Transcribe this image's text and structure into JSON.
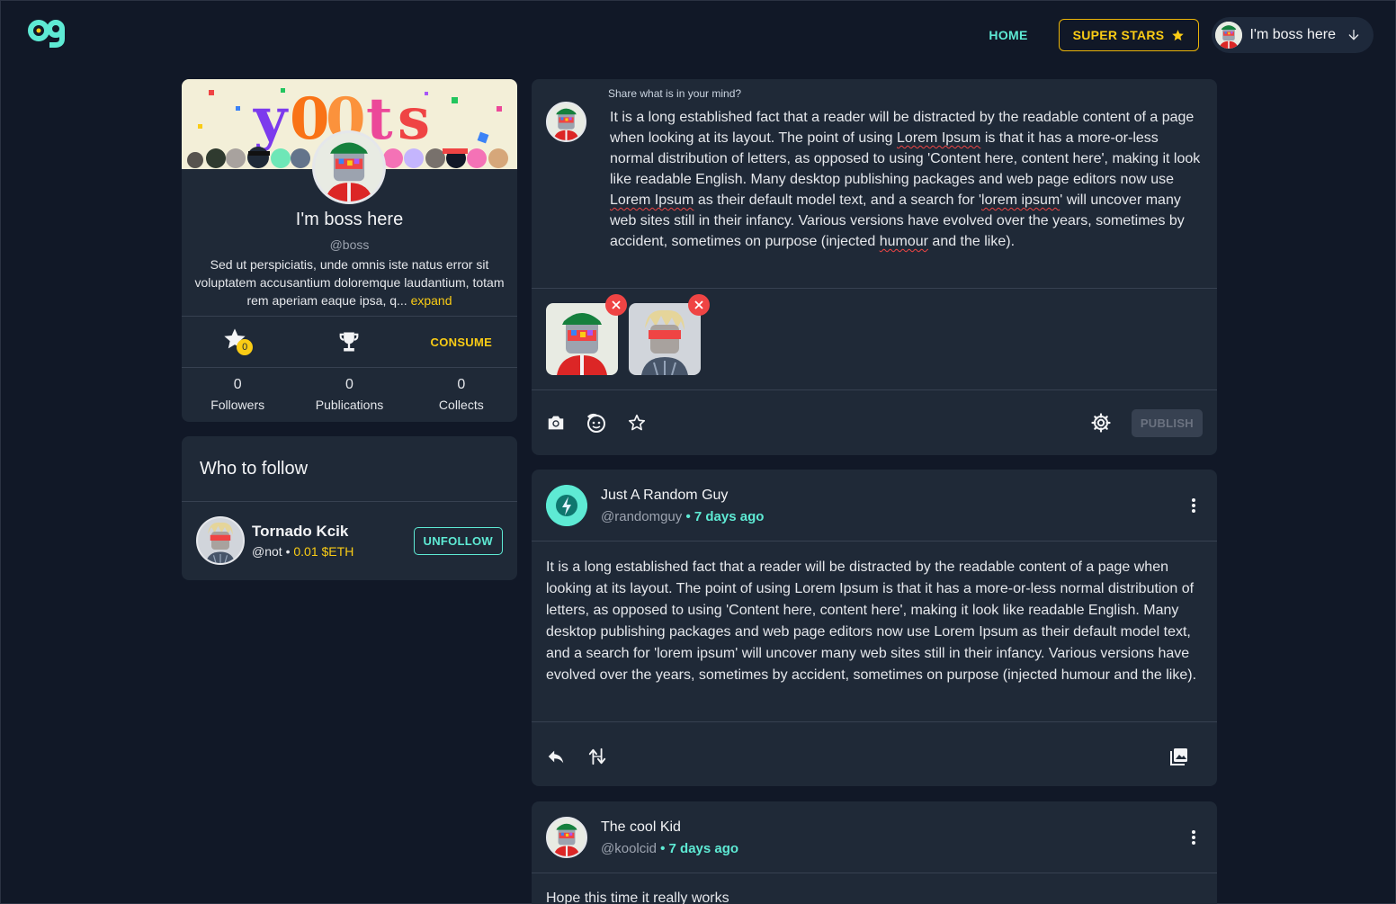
{
  "header": {
    "home_label": "HOME",
    "superstars_label": "SUPER STARS",
    "user_label": "I'm boss here"
  },
  "profile": {
    "name": "I'm boss here",
    "handle": "@boss",
    "bio": "Sed ut perspiciatis, unde omnis iste natus error sit voluptatem accusantium doloremque laudantium, totam rem aperiam eaque ipsa, q...",
    "expand_label": "expand",
    "star_count": "0",
    "consume_label": "CONSUME",
    "stats": [
      {
        "value": "0",
        "label": "Followers"
      },
      {
        "value": "0",
        "label": "Publications"
      },
      {
        "value": "0",
        "label": "Collects"
      }
    ]
  },
  "who_to_follow": {
    "title": "Who to follow",
    "items": [
      {
        "name": "Tornado Kcik",
        "handle": "@not",
        "price": "0.01 $ETH",
        "action": "UNFOLLOW"
      }
    ]
  },
  "composer": {
    "label": "Share what is in your mind?",
    "text_parts": [
      "It is a long established fact that a reader will be distracted by the readable content of a page when looking at its layout. The point of using ",
      "Lorem Ipsum",
      " is that it has a more-or-less normal distribution of letters, as opposed to using 'Content here, content here', making it look like readable English. Many desktop publishing packages and web page editors now use ",
      "Lorem Ipsum",
      " as their default model text, and a search for '",
      "lorem ipsum",
      "' will uncover many web sites still in their infancy. Various versions have evolved over the years, sometimes by accident, sometimes on purpose (injected ",
      "humour",
      " and the like)."
    ],
    "publish_label": "PUBLISH"
  },
  "posts": [
    {
      "name": "Just A Random Guy",
      "handle": "@randomguy",
      "ago": "7 days ago",
      "body": "It is a long established fact that a reader will be distracted by the readable content of a page when looking at its layout. The point of using Lorem Ipsum is that it has a more-or-less normal distribution of letters, as opposed to using 'Content here, content here', making it look like readable English. Many desktop publishing packages and web page editors now use Lorem Ipsum as their default model text, and a search for 'lorem ipsum' will uncover many web sites still in their infancy. Various versions have evolved over the years, sometimes by accident, sometimes on purpose (injected humour and the like)."
    },
    {
      "name": "The cool Kid",
      "handle": "@koolcid",
      "ago": "7 days ago",
      "body": "Hope this time it really works"
    }
  ],
  "icons": {
    "logo": "og-logo",
    "star": "star-icon",
    "trophy": "trophy-icon",
    "camera": "camera-icon",
    "emoji": "emoji-icon",
    "settings": "gear-icon",
    "reply": "reply-icon",
    "mirror": "mirror-icon",
    "gallery": "gallery-icon",
    "more": "kebab-menu-icon"
  },
  "colors": {
    "accent": "#5eead4",
    "gold": "#facc15",
    "background": "#111827",
    "card": "#1f2937",
    "danger": "#ef4444"
  }
}
